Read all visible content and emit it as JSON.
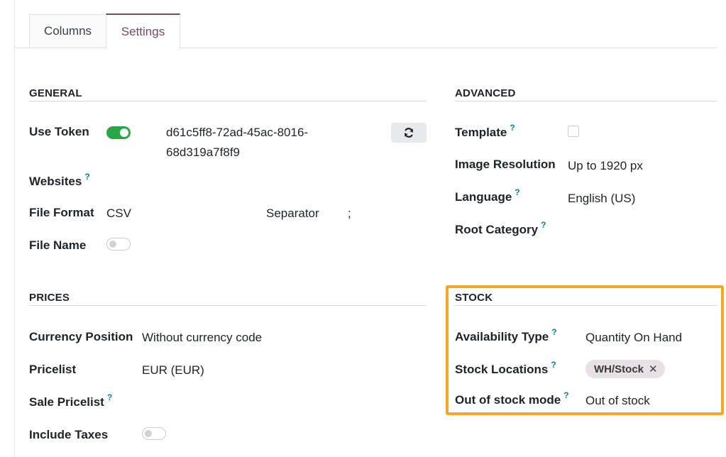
{
  "tabs": {
    "columns": "Columns",
    "settings": "Settings"
  },
  "general": {
    "title": "GENERAL",
    "use_token_label": "Use Token",
    "token_line1": "d61c5ff8-72ad-45ac-8016-",
    "token_line2": "68d319a7f8f9",
    "websites_label": "Websites",
    "file_format_label": "File Format",
    "file_format_value": "CSV",
    "separator_label": "Separator",
    "separator_value": ";",
    "file_name_label": "File Name"
  },
  "advanced": {
    "title": "ADVANCED",
    "template_label": "Template",
    "image_resolution_label": "Image Resolution",
    "image_resolution_value": "Up to 1920 px",
    "language_label": "Language",
    "language_value": "English (US)",
    "root_category_label": "Root Category"
  },
  "prices": {
    "title": "PRICES",
    "currency_position_label": "Currency Position",
    "currency_position_value": "Without currency code",
    "pricelist_label": "Pricelist",
    "pricelist_value": "EUR (EUR)",
    "sale_pricelist_label": "Sale Pricelist",
    "include_taxes_label": "Include Taxes"
  },
  "stock": {
    "title": "STOCK",
    "availability_type_label": "Availability Type",
    "availability_type_value": "Quantity On Hand",
    "stock_locations_label": "Stock Locations",
    "stock_location_tag": "WH/Stock",
    "out_of_stock_mode_label": "Out of stock mode",
    "out_of_stock_mode_value": "Out of stock"
  },
  "help_mark": "?",
  "remove_mark": "✕",
  "toggles": {
    "use_token": true,
    "file_name": false,
    "include_taxes": false
  },
  "template_checked": false,
  "colors": {
    "accent": "#714b67",
    "toggle_on": "#28a745",
    "help": "#0180a5",
    "highlight": "#f5a623"
  },
  "icons": {
    "refresh": "refresh-icon",
    "remove": "close-icon"
  }
}
